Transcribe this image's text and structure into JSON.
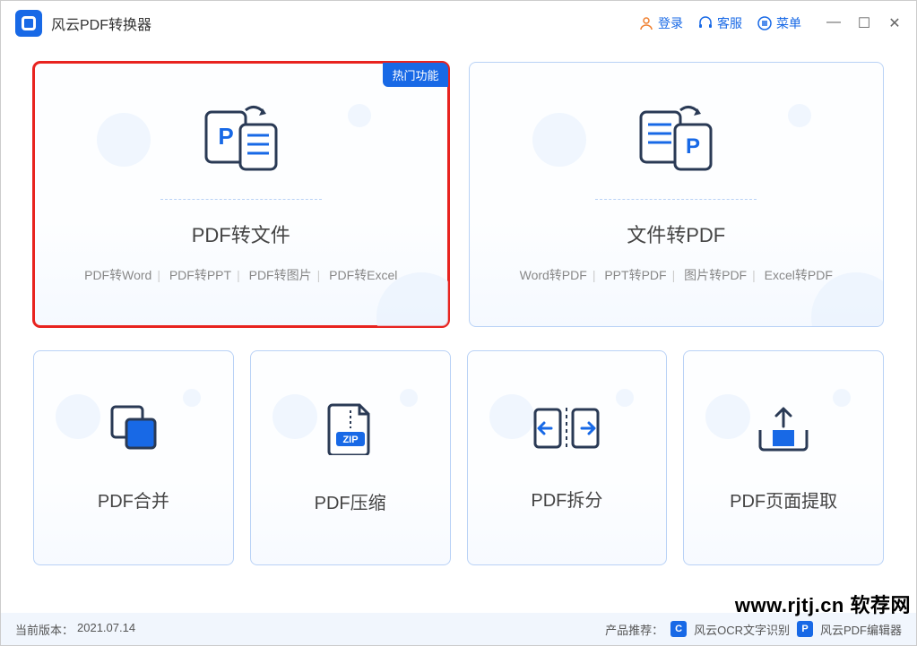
{
  "app": {
    "title": "风云PDF转换器"
  },
  "header": {
    "login": "登录",
    "support": "客服",
    "menu": "菜单"
  },
  "cards": {
    "pdf_to_file": {
      "badge": "热门功能",
      "title": "PDF转文件",
      "options": [
        "PDF转Word",
        "PDF转PPT",
        "PDF转图片",
        "PDF转Excel"
      ]
    },
    "file_to_pdf": {
      "title": "文件转PDF",
      "options": [
        "Word转PDF",
        "PPT转PDF",
        "图片转PDF",
        "Excel转PDF"
      ]
    },
    "merge": {
      "title": "PDF合并"
    },
    "compress": {
      "title": "PDF压缩"
    },
    "split": {
      "title": "PDF拆分"
    },
    "extract": {
      "title": "PDF页面提取"
    }
  },
  "footer": {
    "version_label": "当前版本：",
    "version": "2021.07.14",
    "recommend_label": "产品推荐：",
    "rec1": "风云OCR文字识别",
    "rec2": "风云PDF编辑器"
  },
  "watermark": "www.rjtj.cn 软荐网"
}
